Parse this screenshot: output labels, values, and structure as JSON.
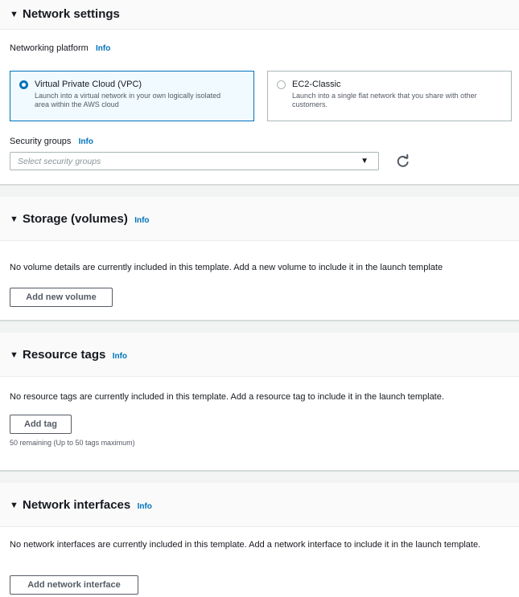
{
  "network_settings": {
    "title": "Network settings",
    "toggle_icon": "caret-down-icon",
    "platform_label": "Networking platform",
    "platform_info": "Info",
    "options": [
      {
        "title": "Virtual Private Cloud (VPC)",
        "desc": "Launch into a virtual network in your own logically isolated area within the AWS cloud",
        "selected": true
      },
      {
        "title": "EC2-Classic",
        "desc": "Launch into a single flat network that you share with other customers.",
        "selected": false
      }
    ],
    "security_groups_label": "Security groups",
    "security_groups_info": "Info",
    "security_groups_placeholder": "Select security groups",
    "refresh_icon": "refresh-icon"
  },
  "storage": {
    "title": "Storage (volumes)",
    "info": "Info",
    "empty_text": "No volume details are currently included in this template. Add a new volume to include it in the launch template",
    "add_button": "Add new volume"
  },
  "resource_tags": {
    "title": "Resource tags",
    "info": "Info",
    "empty_text": "No resource tags are currently included in this template. Add a resource tag to include it in the launch template.",
    "add_button": "Add tag",
    "remaining_note": "50 remaining (Up to 50 tags maximum)"
  },
  "network_interfaces": {
    "title": "Network interfaces",
    "info": "Info",
    "empty_text": "No network interfaces are currently included in this template. Add a network interface to include it in the launch template.",
    "add_button": "Add network interface"
  },
  "colors": {
    "link": "#0073bb",
    "selected_tile_bg": "#f1faff",
    "header_bg": "#fafafa",
    "separator_bg": "#f2f3f3"
  }
}
